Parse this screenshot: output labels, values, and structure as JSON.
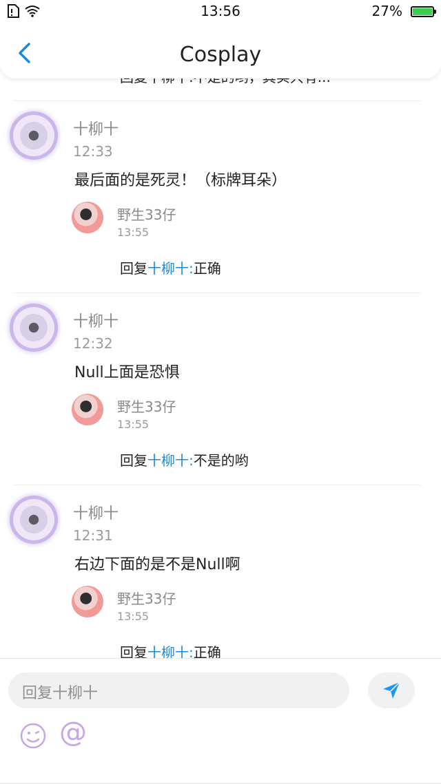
{
  "status_bar": {
    "time": "13:56",
    "battery_percent": "27%",
    "battery_level": 0.27,
    "icons": [
      "sim-icon",
      "wifi-icon",
      "battery-icon"
    ]
  },
  "nav": {
    "title": "Cosplay",
    "back_icon": "chevron-left-icon"
  },
  "partial_top_text": "回复十柳十:不是的哟，其实只有...",
  "threads": [
    {
      "author": "十柳十",
      "time": "12:33",
      "text": "最后面的是死灵！（标牌耳朵）",
      "reply": {
        "author": "野生33仔",
        "time": "13:55",
        "prefix": "回复",
        "to": "十柳十",
        "sep": ":",
        "text": "正确"
      }
    },
    {
      "author": "十柳十",
      "time": "12:32",
      "text": "Null上面是恐惧",
      "reply": {
        "author": "野生33仔",
        "time": "13:55",
        "prefix": "回复",
        "to": "十柳十",
        "sep": ":",
        "text": "不是的哟"
      }
    },
    {
      "author": "十柳十",
      "time": "12:31",
      "text": "右边下面的是不是Null啊",
      "reply": {
        "author": "野生33仔",
        "time": "13:55",
        "prefix": "回复",
        "to": "十柳十",
        "sep": ":",
        "text": "正确"
      }
    }
  ],
  "composer": {
    "placeholder": "回复十柳十",
    "send_icon": "send-icon",
    "emoji_icon": "emoji-icon",
    "mention_symbol": "@"
  },
  "colors": {
    "link": "#1a8ad8",
    "accent": "#c5a6ea",
    "send": "#2196f3"
  }
}
